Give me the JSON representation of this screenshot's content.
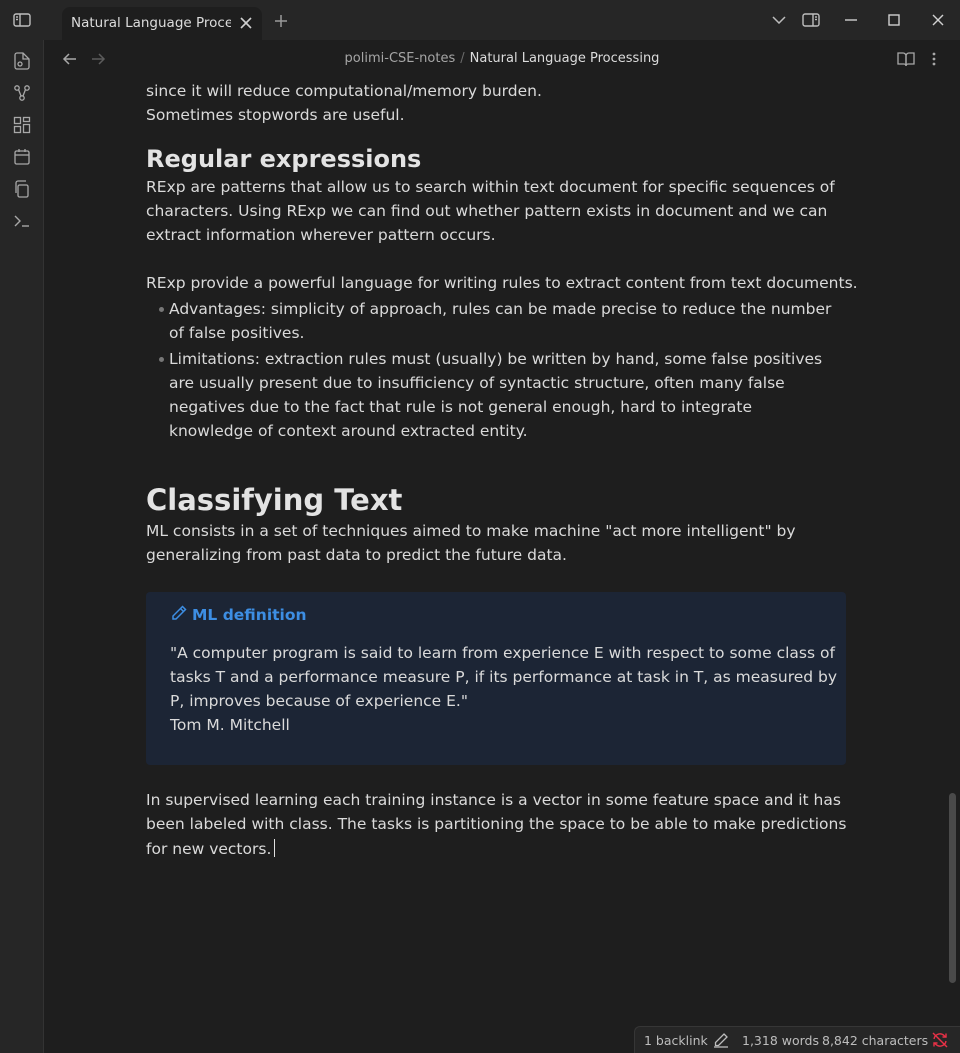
{
  "tab": {
    "title": "Natural Language Proce..."
  },
  "breadcrumb": {
    "parent": "polimi-CSE-notes",
    "separator": "/",
    "current": "Natural Language Processing"
  },
  "content": {
    "intro_lines": [
      "since it will reduce computational/memory burden.",
      "Sometimes stopwords are useful."
    ],
    "regex_heading": "Regular expressions",
    "regex_para_lines": [
      "RExp are patterns that allow us to search within text document for specific sequences of",
      "characters. Using RExp we can find out whether pattern exists in document and we can",
      "extract information wherever pattern occurs."
    ],
    "regex_para2": "RExp provide a powerful language for writing rules to extract content from text documents.",
    "bullets": [
      "Advantages: simplicity of approach, rules can be made precise to reduce the number of false positives.",
      "Limitations: extraction rules must (usually) be written by hand, some false positives are usually present due to insufficiency of syntactic structure, often many false negatives due to the fact that rule is not general enough, hard to integrate knowledge of context around extracted entity."
    ],
    "classifying_heading": "Classifying Text",
    "ml_lines": [
      "ML consists in a set of techniques aimed to make machine \"act more intelligent\" by",
      "generalizing from past data to predict the future data."
    ],
    "callout": {
      "title": "ML definition",
      "quote": "\"A computer program is said to learn from experience E with respect to some class of tasks T and a performance measure P, if its performance at task in T, as measured by P, improves because of experience E.\"",
      "author": "Tom M. Mitchell"
    },
    "supervised_lines": [
      "In supervised learning each training instance is a vector in some feature space and it has",
      "been labeled with class. The tasks is partitioning the space to be able to make predictions",
      "for new vectors."
    ]
  },
  "statusbar": {
    "backlinks": "1 backlink",
    "words": "1,318 words",
    "characters": "8,842 characters"
  },
  "icons": {
    "sidebar_toggle": "sidebar-left-icon",
    "new_tab": "plus-icon",
    "tab_list": "chevron-down-icon",
    "right_sidebar": "sidebar-right-icon",
    "minimize": "minimize-icon",
    "maximize": "maximize-icon",
    "close": "close-icon",
    "ribbon": [
      "files-icon",
      "graph-icon",
      "canvas-icon",
      "calendar-icon",
      "copy-icon",
      "terminal-icon"
    ],
    "back": "arrow-left-icon",
    "forward": "arrow-right-icon",
    "reading_view": "book-open-icon",
    "more_options": "more-vertical-icon",
    "edit": "pencil-icon",
    "sync": "sync-off-icon"
  },
  "colors": {
    "accent": "#3d8ee3",
    "callout_bg": "#1c2535",
    "sync_error": "#e93147",
    "background": "#1e1e1e"
  }
}
